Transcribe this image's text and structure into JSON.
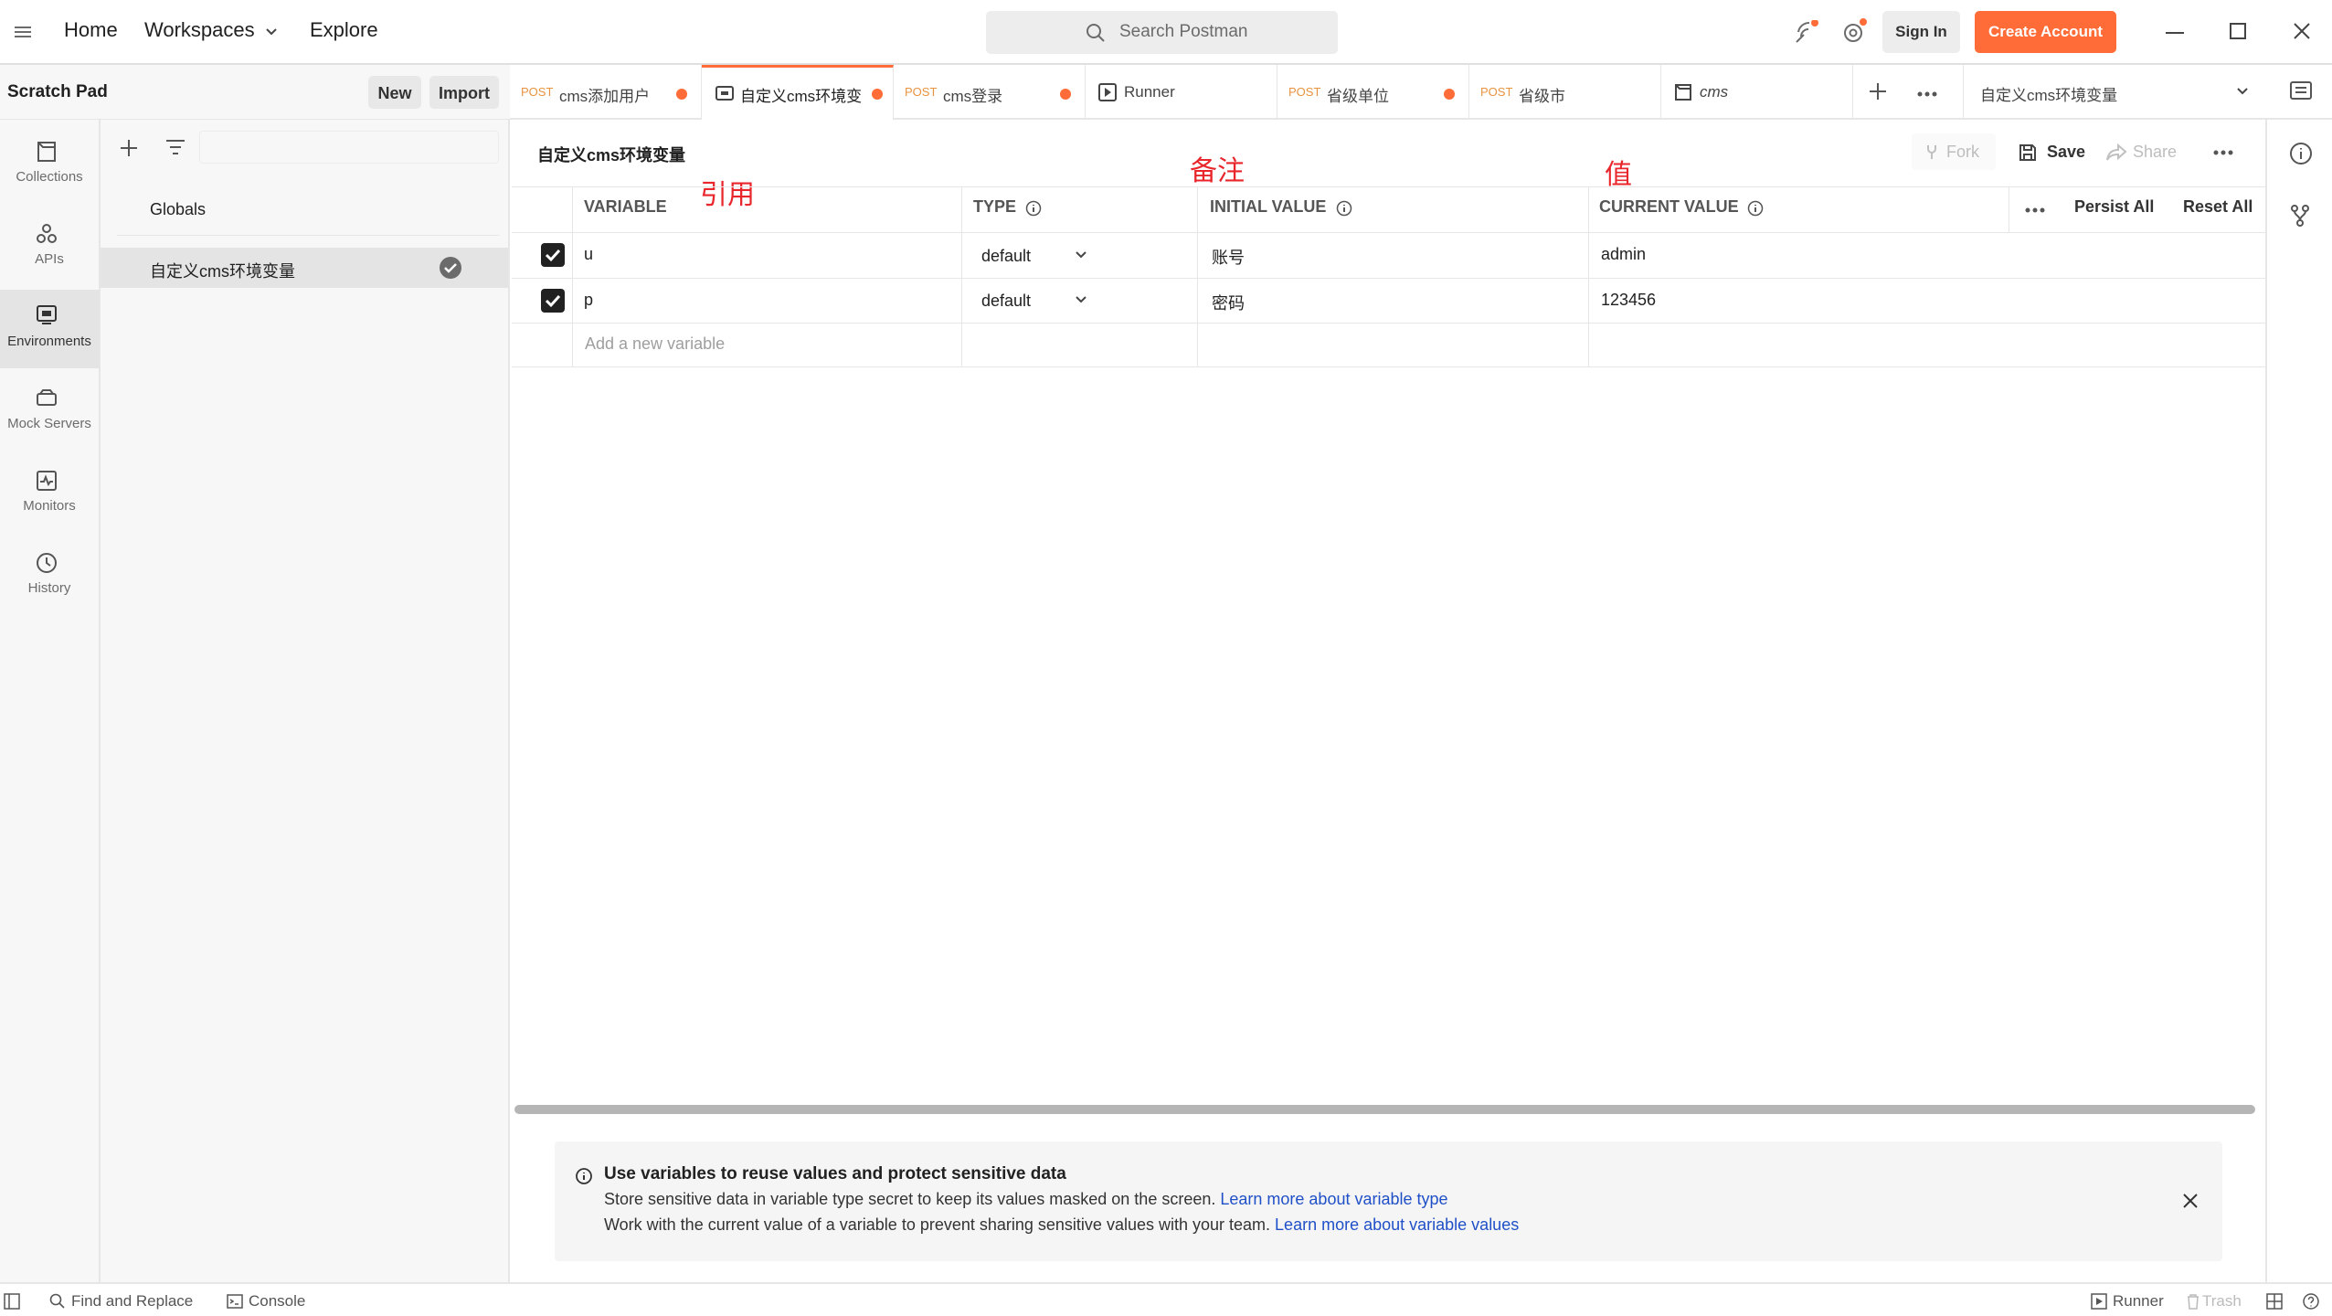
{
  "topbar": {
    "home": "Home",
    "workspaces": "Workspaces",
    "explore": "Explore",
    "search_placeholder": "Search Postman",
    "sign_in": "Sign In",
    "create_account": "Create Account",
    "accent_color": "#ff6c37"
  },
  "sidebar": {
    "title": "Scratch Pad",
    "new_label": "New",
    "import_label": "Import",
    "rail": [
      {
        "label": "Collections",
        "icon": "collections-icon"
      },
      {
        "label": "APIs",
        "icon": "apis-icon"
      },
      {
        "label": "Environments",
        "icon": "environments-icon"
      },
      {
        "label": "Mock Servers",
        "icon": "mock-servers-icon"
      },
      {
        "label": "Monitors",
        "icon": "monitors-icon"
      },
      {
        "label": "History",
        "icon": "history-icon"
      }
    ],
    "env_items": [
      {
        "label": "Globals"
      },
      {
        "label": "自定义cms环境变量",
        "active": true
      }
    ]
  },
  "tabs": [
    {
      "method": "POST",
      "title": "cms添加用户",
      "unsaved": true
    },
    {
      "method": "",
      "title": "自定义cms环境变",
      "unsaved": true,
      "active": true,
      "icon": "environment-icon"
    },
    {
      "method": "POST",
      "title": "cms登录",
      "unsaved": true
    },
    {
      "method": "",
      "title": "Runner",
      "icon": "runner-icon"
    },
    {
      "method": "POST",
      "title": "省级单位",
      "unsaved": true
    },
    {
      "method": "POST",
      "title": "省级市"
    },
    {
      "method": "",
      "title": "cms",
      "icon": "collection-icon"
    }
  ],
  "env_selector": "自定义cms环境变量",
  "main": {
    "title": "自定义cms环境变量",
    "fork": "Fork",
    "save": "Save",
    "share": "Share",
    "annotations": {
      "variable": "引用",
      "initial": "备注",
      "current": "值"
    },
    "columns": {
      "variable": "VARIABLE",
      "type": "TYPE",
      "initial": "INITIAL VALUE",
      "current": "CURRENT VALUE",
      "persist_all": "Persist All",
      "reset_all": "Reset All"
    },
    "rows": [
      {
        "checked": true,
        "variable": "u",
        "type": "default",
        "initial": "账号",
        "current": "admin"
      },
      {
        "checked": true,
        "variable": "p",
        "type": "default",
        "initial": "密码",
        "current": "123456"
      }
    ],
    "add_placeholder": "Add a new variable"
  },
  "notice": {
    "title": "Use variables to reuse values and protect sensitive data",
    "line1": "Store sensitive data in variable type secret to keep its values masked on the screen.",
    "link1": "Learn more about variable type",
    "line2": "Work with the current value of a variable to prevent sharing sensitive values with your team.",
    "link2": "Learn more about variable values"
  },
  "statusbar": {
    "find_replace": "Find and Replace",
    "console": "Console",
    "runner": "Runner",
    "trash": "Trash"
  }
}
